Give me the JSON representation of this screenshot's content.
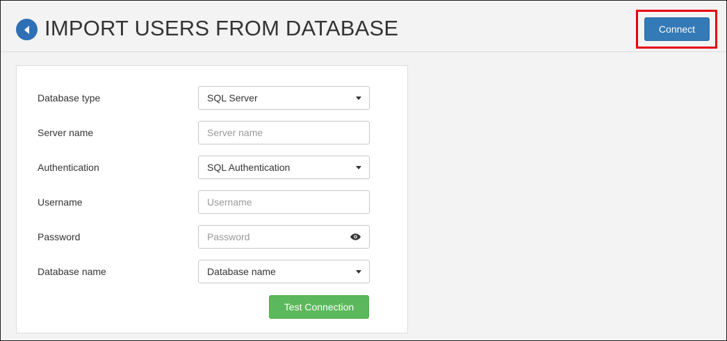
{
  "header": {
    "title": "IMPORT USERS FROM DATABASE",
    "back_icon": "chevron-left-circle-icon",
    "connect_label": "Connect",
    "highlight_color": "#e8000b",
    "primary_color": "#337ab7"
  },
  "form": {
    "database_type": {
      "label": "Database type",
      "value": "SQL Server"
    },
    "server_name": {
      "label": "Server name",
      "value": "",
      "placeholder": "Server name"
    },
    "authentication": {
      "label": "Authentication",
      "value": "SQL Authentication"
    },
    "username": {
      "label": "Username",
      "value": "",
      "placeholder": "Username"
    },
    "password": {
      "label": "Password",
      "value": "",
      "placeholder": "Password",
      "icon": "eye-icon"
    },
    "database_name": {
      "label": "Database name",
      "value": "Database name"
    },
    "test_connection_label": "Test Connection",
    "success_color": "#5cb85c"
  }
}
